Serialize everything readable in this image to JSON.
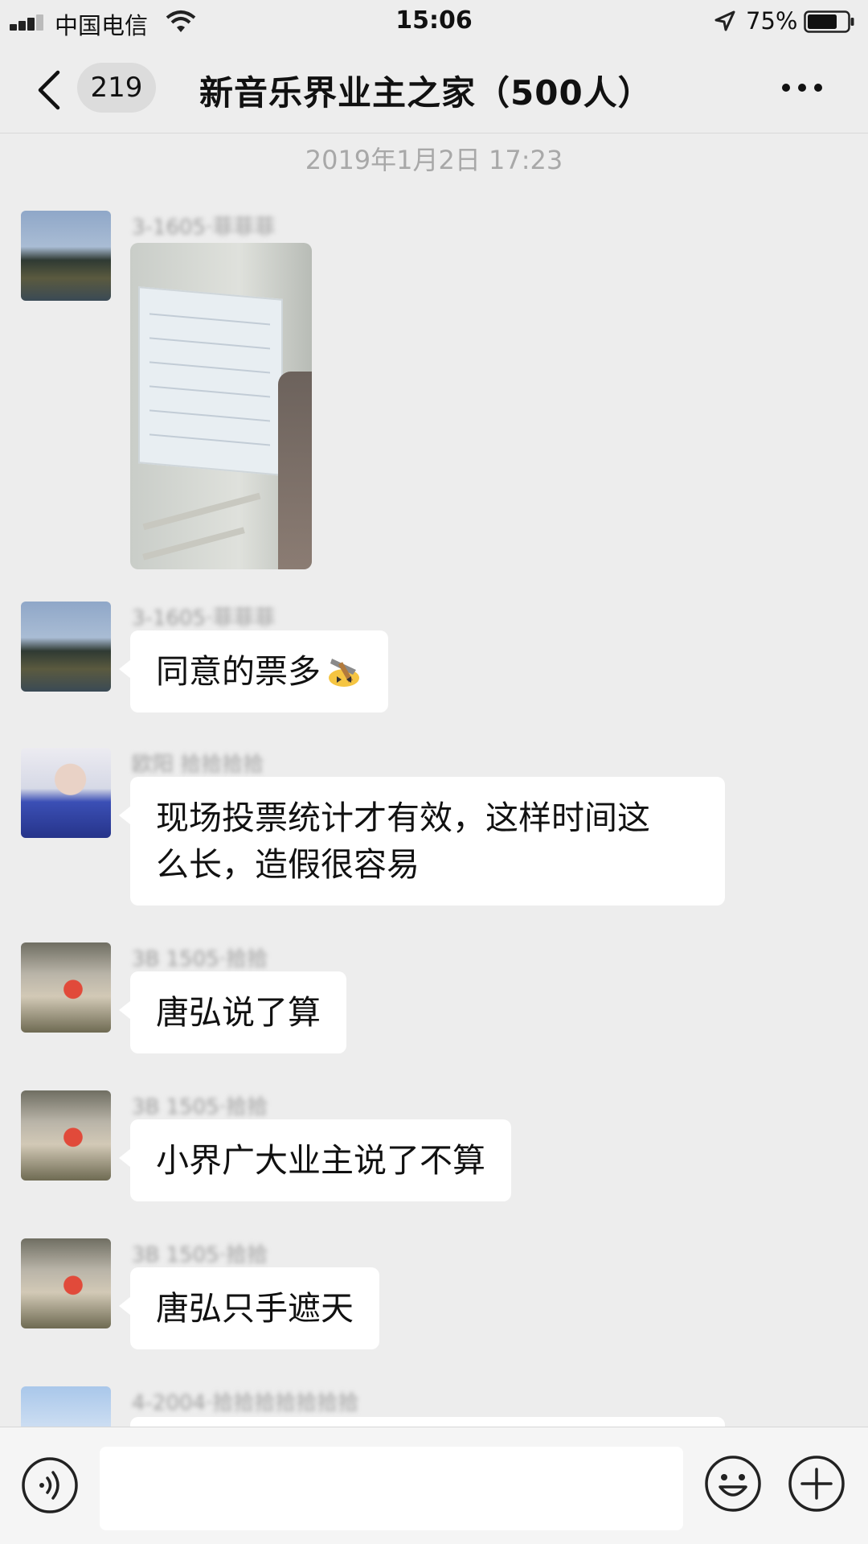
{
  "status_bar": {
    "carrier": "中国电信",
    "time": "15:06",
    "battery": "75%",
    "battery_level": 0.75
  },
  "nav": {
    "unread_count": "219",
    "title": "新音乐界业主之家（500人）"
  },
  "chat": {
    "timestamp": "2019年1月2日 17:23",
    "messages": [
      {
        "sender": "3-1605·菲菲菲",
        "type": "image"
      },
      {
        "sender": "3-1605·菲菲菲",
        "type": "text",
        "text": "同意的票多",
        "emoji": "hammer-emoji"
      },
      {
        "sender": "欧阳 拾拾拾拾",
        "type": "text",
        "text_lines": [
          "现场投票统计才有效，这样时间这",
          "么长，造假很容易"
        ]
      },
      {
        "sender": "3B 1505·拾拾",
        "type": "text",
        "text": "唐弘说了算"
      },
      {
        "sender": "3B 1505·拾拾",
        "type": "text",
        "text": "小界广大业主说了不算"
      },
      {
        "sender": "3B 1505·拾拾",
        "type": "text",
        "text": "唐弘只手遮天"
      },
      {
        "sender": "4-2004·拾拾拾拾拾拾拾",
        "type": "text",
        "text": ""
      }
    ]
  },
  "input_bar": {
    "value": ""
  },
  "icons": {
    "back": "chevron-left-icon",
    "more": "more-dots-icon",
    "voice": "voice-icon",
    "emoji": "emoji-icon",
    "plus": "plus-icon"
  }
}
